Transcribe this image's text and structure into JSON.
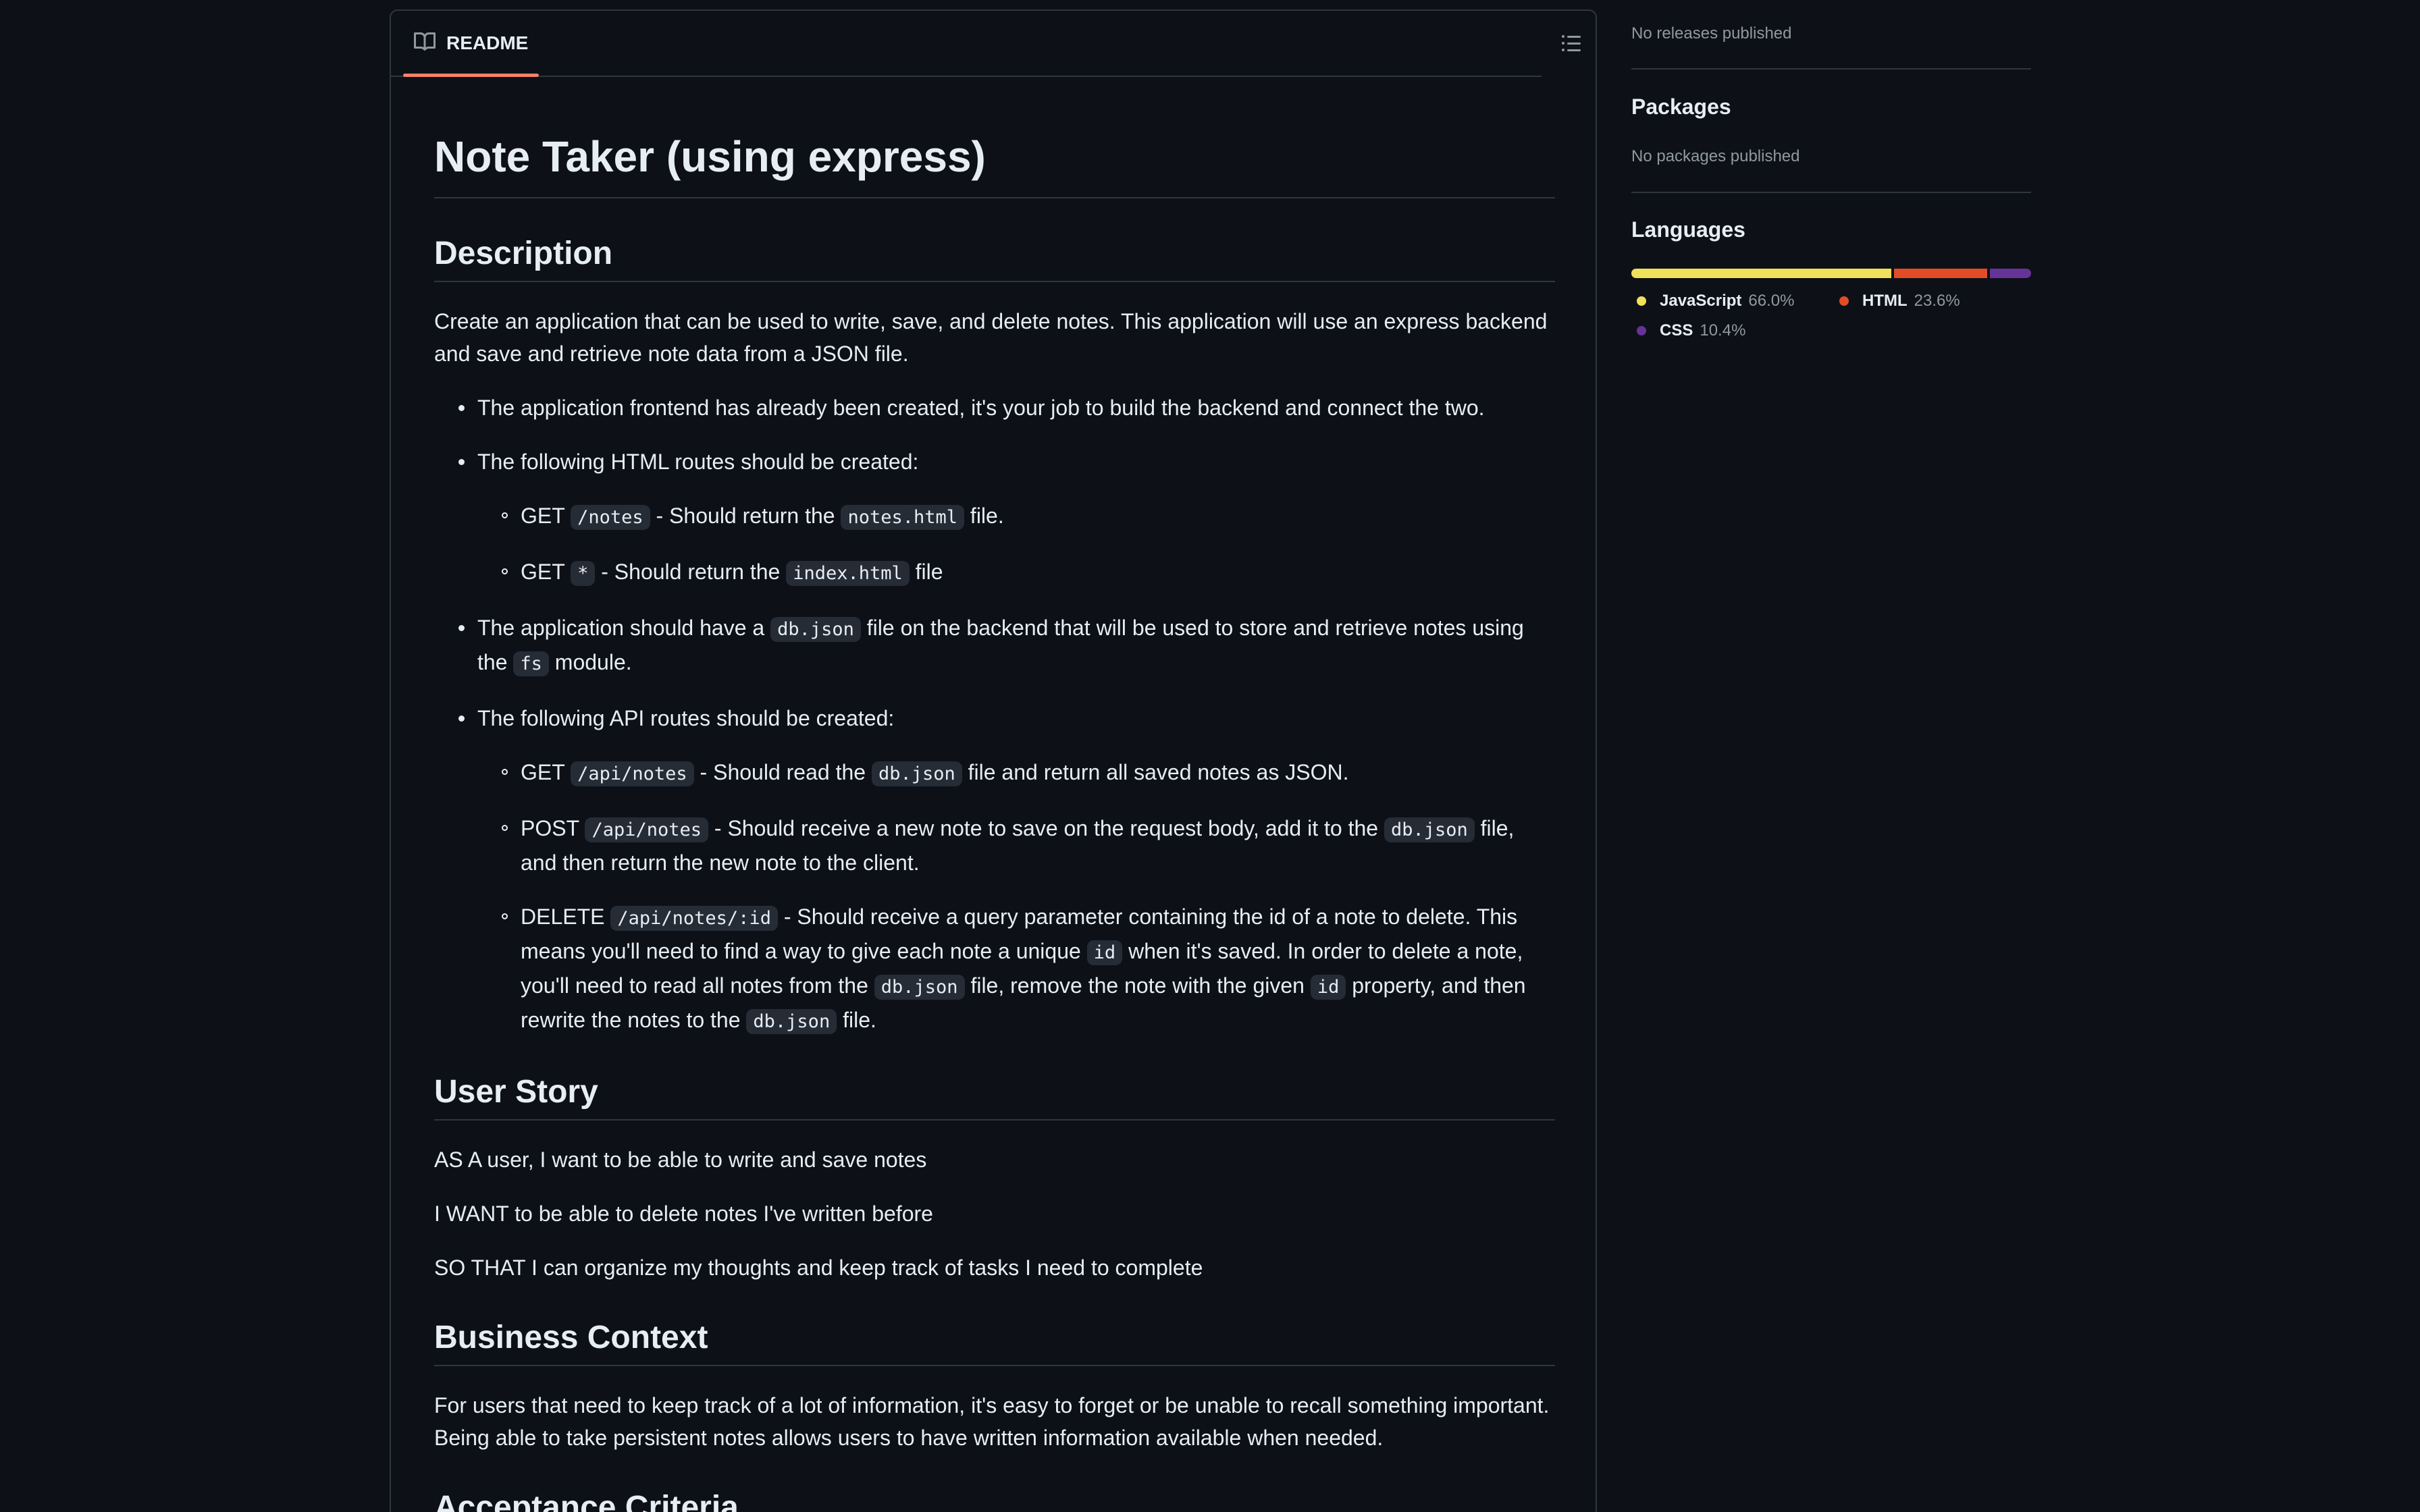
{
  "readme": {
    "tab_label": "README",
    "title": "Note Taker (using express)",
    "description": {
      "heading": "Description",
      "intro": "Create an application that can be used to write, save, and delete notes. This application will use an express backend and save and retrieve note data from a JSON file.",
      "b1": "The application frontend has already been created, it's your job to build the backend and connect the two.",
      "b2": "The following HTML routes should be created:",
      "html_r1": {
        "method": "GET",
        "path": "/notes",
        "mid": "- Should return the",
        "file": "notes.html",
        "end": "file."
      },
      "html_r2": {
        "method": "GET",
        "path": "*",
        "mid": "- Should return the",
        "file": "index.html",
        "end": "file"
      },
      "b3": {
        "pre": "The application should have a",
        "file": "db.json",
        "mid": "file on the backend that will be used to store and retrieve notes using the",
        "module": "fs",
        "end": "module."
      },
      "b4": "The following API routes should be created:",
      "api_r1": {
        "method": "GET",
        "path": "/api/notes",
        "mid": "- Should read the",
        "file": "db.json",
        "end": "file and return all saved notes as JSON."
      },
      "api_r2": {
        "method": "POST",
        "path": "/api/notes",
        "mid": "- Should receive a new note to save on the request body, add it to the",
        "file": "db.json",
        "end": "file, and then return the new note to the client."
      },
      "api_r3": {
        "method": "DELETE",
        "path": "/api/notes/:id",
        "t1": "- Should receive a query parameter containing the id of a note to delete. This means you'll need to find a way to give each note a unique",
        "c1": "id",
        "t2": "when it's saved. In order to delete a note, you'll need to read all notes from the",
        "c2": "db.json",
        "t3": "file, remove the note with the given",
        "c3": "id",
        "t4": "property, and then rewrite the notes to the",
        "c4": "db.json",
        "t5": "file."
      }
    },
    "user_story": {
      "heading": "User Story",
      "l1": "AS A user, I want to be able to write and save notes",
      "l2": "I WANT to be able to delete notes I've written before",
      "l3": "SO THAT I can organize my thoughts and keep track of tasks I need to complete"
    },
    "business": {
      "heading": "Business Context",
      "text": "For users that need to keep track of a lot of information, it's easy to forget or be unable to recall something important. Being able to take persistent notes allows users to have written information available when needed."
    },
    "acceptance": {
      "heading": "Acceptance Criteria"
    }
  },
  "sidebar": {
    "releases_empty": "No releases published",
    "packages_heading": "Packages",
    "packages_empty": "No packages published",
    "languages_heading": "Languages",
    "languages": [
      {
        "name": "JavaScript",
        "percent": "66.0%",
        "value": 66.0,
        "color": "#f1e05a"
      },
      {
        "name": "HTML",
        "percent": "23.6%",
        "value": 23.6,
        "color": "#e34c26"
      },
      {
        "name": "CSS",
        "percent": "10.4%",
        "value": 10.4,
        "color": "#663399"
      }
    ]
  }
}
